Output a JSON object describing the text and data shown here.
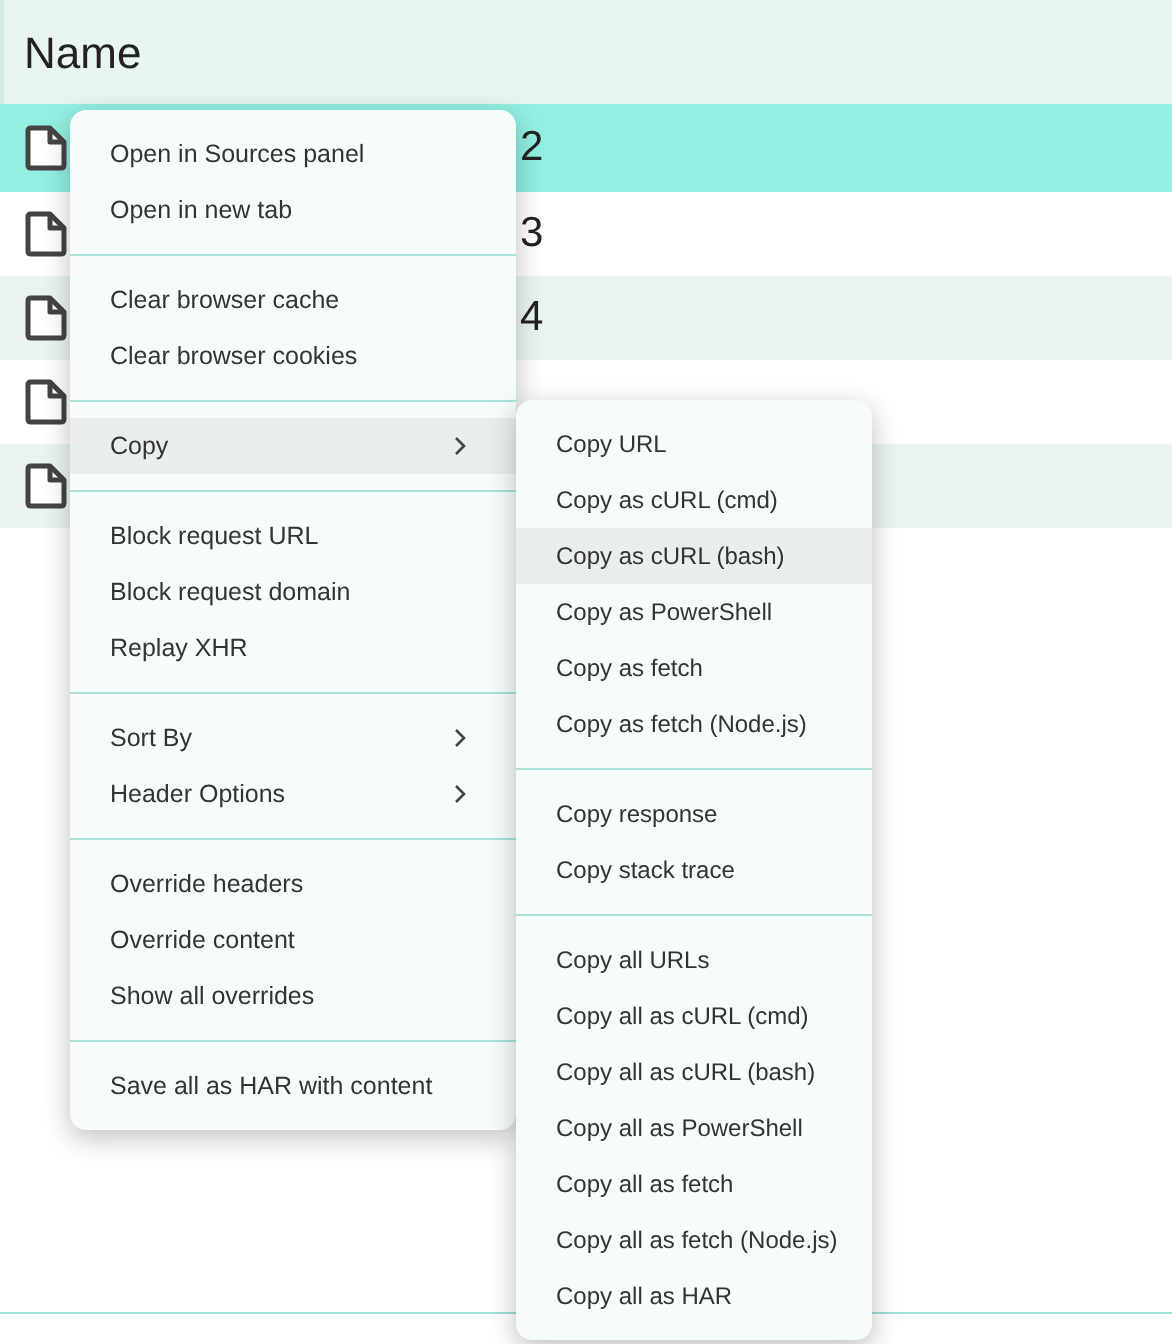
{
  "table": {
    "column_header": "Name",
    "rows": [
      {
        "text": "2",
        "selected": true
      },
      {
        "text": "3",
        "selected": false
      },
      {
        "text": "4",
        "selected": false
      },
      {
        "selected": false
      },
      {
        "selected": false
      }
    ]
  },
  "context_menu": {
    "groups": [
      [
        {
          "label": "Open in Sources panel",
          "submenu": false,
          "highlighted": false
        },
        {
          "label": "Open in new tab",
          "submenu": false,
          "highlighted": false
        }
      ],
      [
        {
          "label": "Clear browser cache",
          "submenu": false,
          "highlighted": false
        },
        {
          "label": "Clear browser cookies",
          "submenu": false,
          "highlighted": false
        }
      ],
      [
        {
          "label": "Copy",
          "submenu": true,
          "highlighted": true
        }
      ],
      [
        {
          "label": "Block request URL",
          "submenu": false,
          "highlighted": false
        },
        {
          "label": "Block request domain",
          "submenu": false,
          "highlighted": false
        },
        {
          "label": "Replay XHR",
          "submenu": false,
          "highlighted": false
        }
      ],
      [
        {
          "label": "Sort By",
          "submenu": true,
          "highlighted": false
        },
        {
          "label": "Header Options",
          "submenu": true,
          "highlighted": false
        }
      ],
      [
        {
          "label": "Override headers",
          "submenu": false,
          "highlighted": false
        },
        {
          "label": "Override content",
          "submenu": false,
          "highlighted": false
        },
        {
          "label": "Show all overrides",
          "submenu": false,
          "highlighted": false
        }
      ],
      [
        {
          "label": "Save all as HAR with content",
          "submenu": false,
          "highlighted": false
        }
      ]
    ]
  },
  "copy_submenu": {
    "groups": [
      [
        {
          "label": "Copy URL",
          "highlighted": false
        },
        {
          "label": "Copy as cURL (cmd)",
          "highlighted": false
        },
        {
          "label": "Copy as cURL (bash)",
          "highlighted": true
        },
        {
          "label": "Copy as PowerShell",
          "highlighted": false
        },
        {
          "label": "Copy as fetch",
          "highlighted": false
        },
        {
          "label": "Copy as fetch (Node.js)",
          "highlighted": false
        }
      ],
      [
        {
          "label": "Copy response",
          "highlighted": false
        },
        {
          "label": "Copy stack trace",
          "highlighted": false
        }
      ],
      [
        {
          "label": "Copy all URLs",
          "highlighted": false
        },
        {
          "label": "Copy all as cURL (cmd)",
          "highlighted": false
        },
        {
          "label": "Copy all as cURL (bash)",
          "highlighted": false
        },
        {
          "label": "Copy all as PowerShell",
          "highlighted": false
        },
        {
          "label": "Copy all as fetch",
          "highlighted": false
        },
        {
          "label": "Copy all as fetch (Node.js)",
          "highlighted": false
        },
        {
          "label": "Copy all as HAR",
          "highlighted": false
        }
      ]
    ]
  }
}
